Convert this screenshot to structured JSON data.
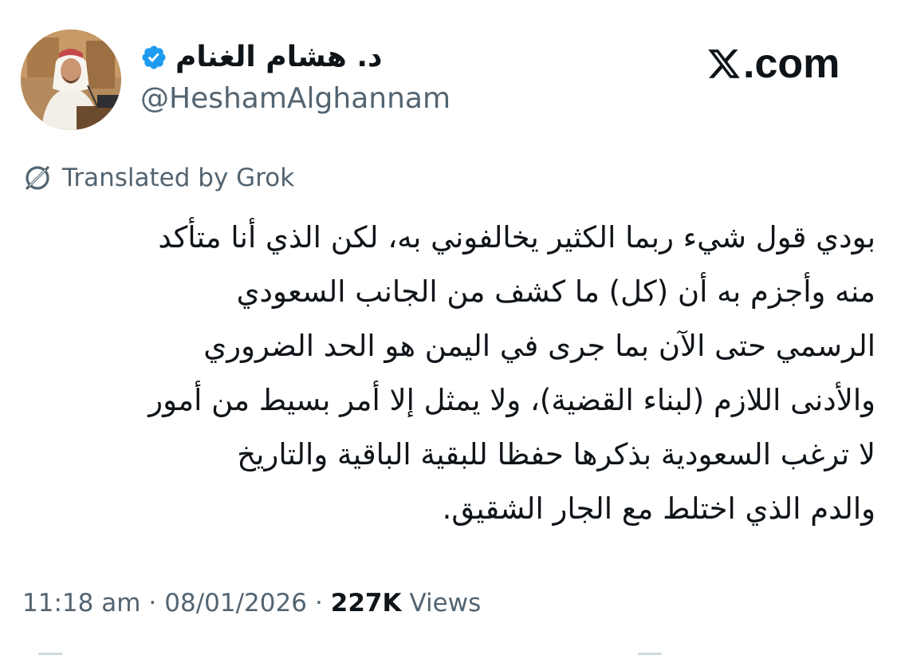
{
  "header": {
    "display_name": "د. هشام الغنام",
    "handle": "@HeshamAlghannam",
    "site_suffix": ".com",
    "avatar_icon": "profile-photo",
    "verified_icon": "verified-badge-icon",
    "verified_color": "#1d9bf0"
  },
  "translation": {
    "label": "Translated by Grok",
    "icon": "grok-icon"
  },
  "tweet": {
    "lines": [
      "بودي قول شيء ربما الكثير يخالفوني به، لكن الذي أنا متأكد",
      "منه وأجزم به أن (كل) ما كشف من الجانب السعودي",
      "الرسمي حتى الآن بما جرى في اليمن هو الحد الضروري",
      "والأدنى اللازم (لبناء القضية)، ولا يمثل إلا أمر بسيط من أمور",
      "لا ترغب السعودية بذكرها حفظا للبقية الباقية والتاريخ",
      "والدم الذي اختلط مع الجار الشقيق."
    ]
  },
  "meta": {
    "time": "11:18 am",
    "separator": "·",
    "date": "08/01/2026",
    "views_count": "227K",
    "views_label": "Views"
  },
  "colors": {
    "text_primary": "#0f1419",
    "text_secondary": "#536471",
    "accent": "#1d9bf0",
    "background": "#ffffff"
  }
}
